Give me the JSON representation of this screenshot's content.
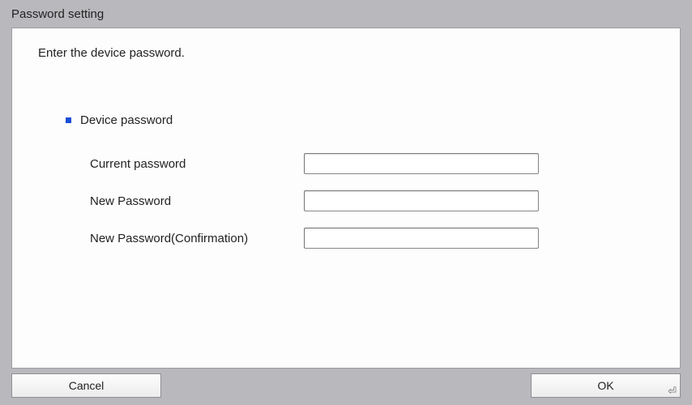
{
  "title": "Password setting",
  "instruction": "Enter the device password.",
  "section": {
    "heading": "Device password",
    "fields": {
      "current": {
        "label": "Current password",
        "value": ""
      },
      "new": {
        "label": "New Password",
        "value": ""
      },
      "confirm": {
        "label": "New Password(Confirmation)",
        "value": ""
      }
    }
  },
  "buttons": {
    "cancel": "Cancel",
    "ok": "OK"
  }
}
